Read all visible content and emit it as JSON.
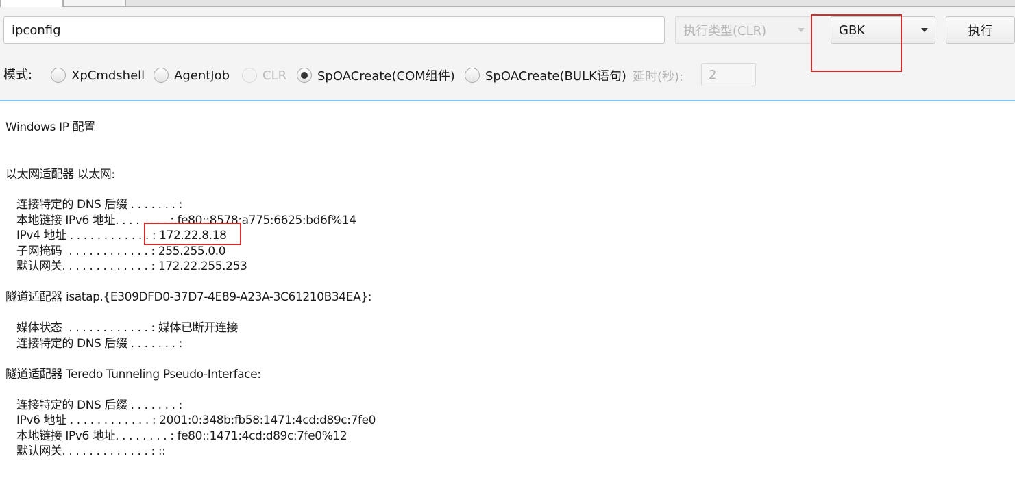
{
  "tabs": [
    "",
    ""
  ],
  "command": {
    "value": "ipconfig"
  },
  "exec_type": {
    "value": "执行类型(CLR)",
    "disabled": true
  },
  "encoding": {
    "value": "GBK"
  },
  "run_button": {
    "label": "执行"
  },
  "mode": {
    "label": "模式:",
    "options": [
      {
        "label": "XpCmdshell",
        "selected": false,
        "disabled": false
      },
      {
        "label": "AgentJob",
        "selected": false,
        "disabled": false
      },
      {
        "label": "CLR",
        "selected": false,
        "disabled": true
      },
      {
        "label": "SpOACreate(COM组件)",
        "selected": true,
        "disabled": false
      },
      {
        "label": "SpOACreate(BULK语句)",
        "selected": false,
        "disabled": false
      }
    ]
  },
  "delay": {
    "label": "延时(秒):",
    "value": "2"
  },
  "output": {
    "lines": [
      "Windows IP 配置",
      "以太网适配器 以太网:",
      "连接特定的 DNS 后缀 . . . . . . . :",
      "本地链接 IPv6 地址. . . . . . . . : fe80::8578:a775:6625:bd6f%14",
      "IPv4 地址 . . . . . . . . . . . . : 172.22.8.18",
      "子网掩码  . . . . . . . . . . . . : 255.255.0.0",
      "默认网关. . . . . . . . . . . . . : 172.22.255.253",
      "隧道适配器 isatap.{E309DFD0-37D7-4E89-A23A-3C61210B34EA}:",
      "媒体状态  . . . . . . . . . . . . : 媒体已断开连接",
      "连接特定的 DNS 后缀 . . . . . . . :",
      "隧道适配器 Teredo Tunneling Pseudo-Interface:",
      "连接特定的 DNS 后缀 . . . . . . . :",
      "IPv6 地址 . . . . . . . . . . . . : 2001:0:348b:fb58:1471:4cd:d89c:7fe0",
      "本地链接 IPv6 地址. . . . . . . . : fe80::1471:4cd:d89c:7fe0%12",
      "默认网关. . . . . . . . . . . . . : ::"
    ]
  },
  "colors": {
    "highlight": "#d42a2a",
    "accent_line": "#7ec4ee",
    "toolbar_bg": "#f4f4f4"
  }
}
